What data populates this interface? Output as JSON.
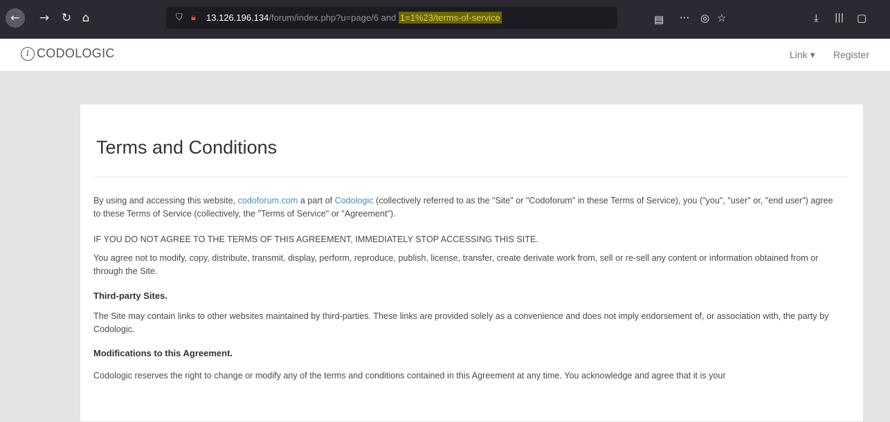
{
  "browser": {
    "url_host": "13.126.196.134",
    "url_path": "/forum/index.php?u=page/6 and ",
    "url_highlight": "1=1%23/terms-of-service",
    "back_icon": "←",
    "forward_icon": "→",
    "reload_icon": "↻",
    "home_icon": "⌂",
    "reader_icon": "▤",
    "more_icon": "···",
    "pocket_icon": "◎",
    "bookmark_icon": "☆",
    "download_icon": "⤓",
    "library_icon": "|||",
    "sidebar_icon": "▢"
  },
  "site": {
    "logo_mark": "i",
    "logo_text": "CODOLOGIC",
    "nav_link": "Link ▾",
    "nav_register": "Register"
  },
  "page": {
    "title": "Terms and Conditions",
    "p1_a": "By using and accessing this website, ",
    "p1_link1": "codoforum.com",
    "p1_b": " a part of ",
    "p1_link2": "Codologic",
    "p1_c": " (collectively referred to as the \"Site\" or \"Codoforum\" in these Terms of Service), you (\"you\", \"user\" or, \"end user\") agree to these Terms of Service (collectively, the \"Terms of Service\" or \"Agreement\").",
    "p2": "IF YOU DO NOT AGREE TO THE TERMS OF THIS AGREEMENT, IMMEDIATELY STOP ACCESSING THIS SITE.",
    "p3": "You agree not to modify, copy, distribute, transmit, display, perform, reproduce, publish, license, transfer, create derivate work from, sell or re-sell any content or information obtained from or through the Site.",
    "h_third": "Third-party Sites.",
    "p4": "The Site may contain links to other websites maintained by third-parties. These links are provided solely as a convenience and does not imply endorsement of, or association with, the party by Codologic.",
    "h_mod": "Modifications to this Agreement.",
    "p5": "Codologic reserves the right to change or modify any of the terms and conditions contained in this Agreement at any time. You acknowledge and agree that it is your"
  }
}
